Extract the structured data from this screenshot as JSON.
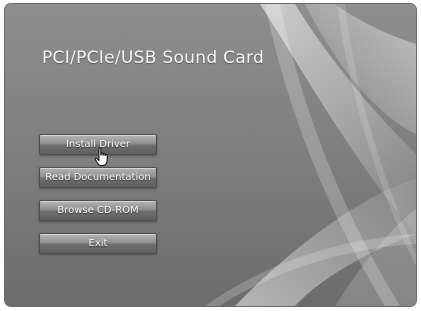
{
  "app": {
    "title": "PCI/PCIe/USB Sound Card"
  },
  "menu": {
    "items": [
      {
        "label": "Install Driver"
      },
      {
        "label": "Read Documentation"
      },
      {
        "label": "Browse CD-ROM"
      },
      {
        "label": "Exit"
      }
    ]
  },
  "cursor": {
    "icon": "hand-pointer-icon"
  },
  "colors": {
    "background": "#7d7d7d",
    "button_text": "#f7f7f7",
    "title_text": "#f4f4f4"
  }
}
